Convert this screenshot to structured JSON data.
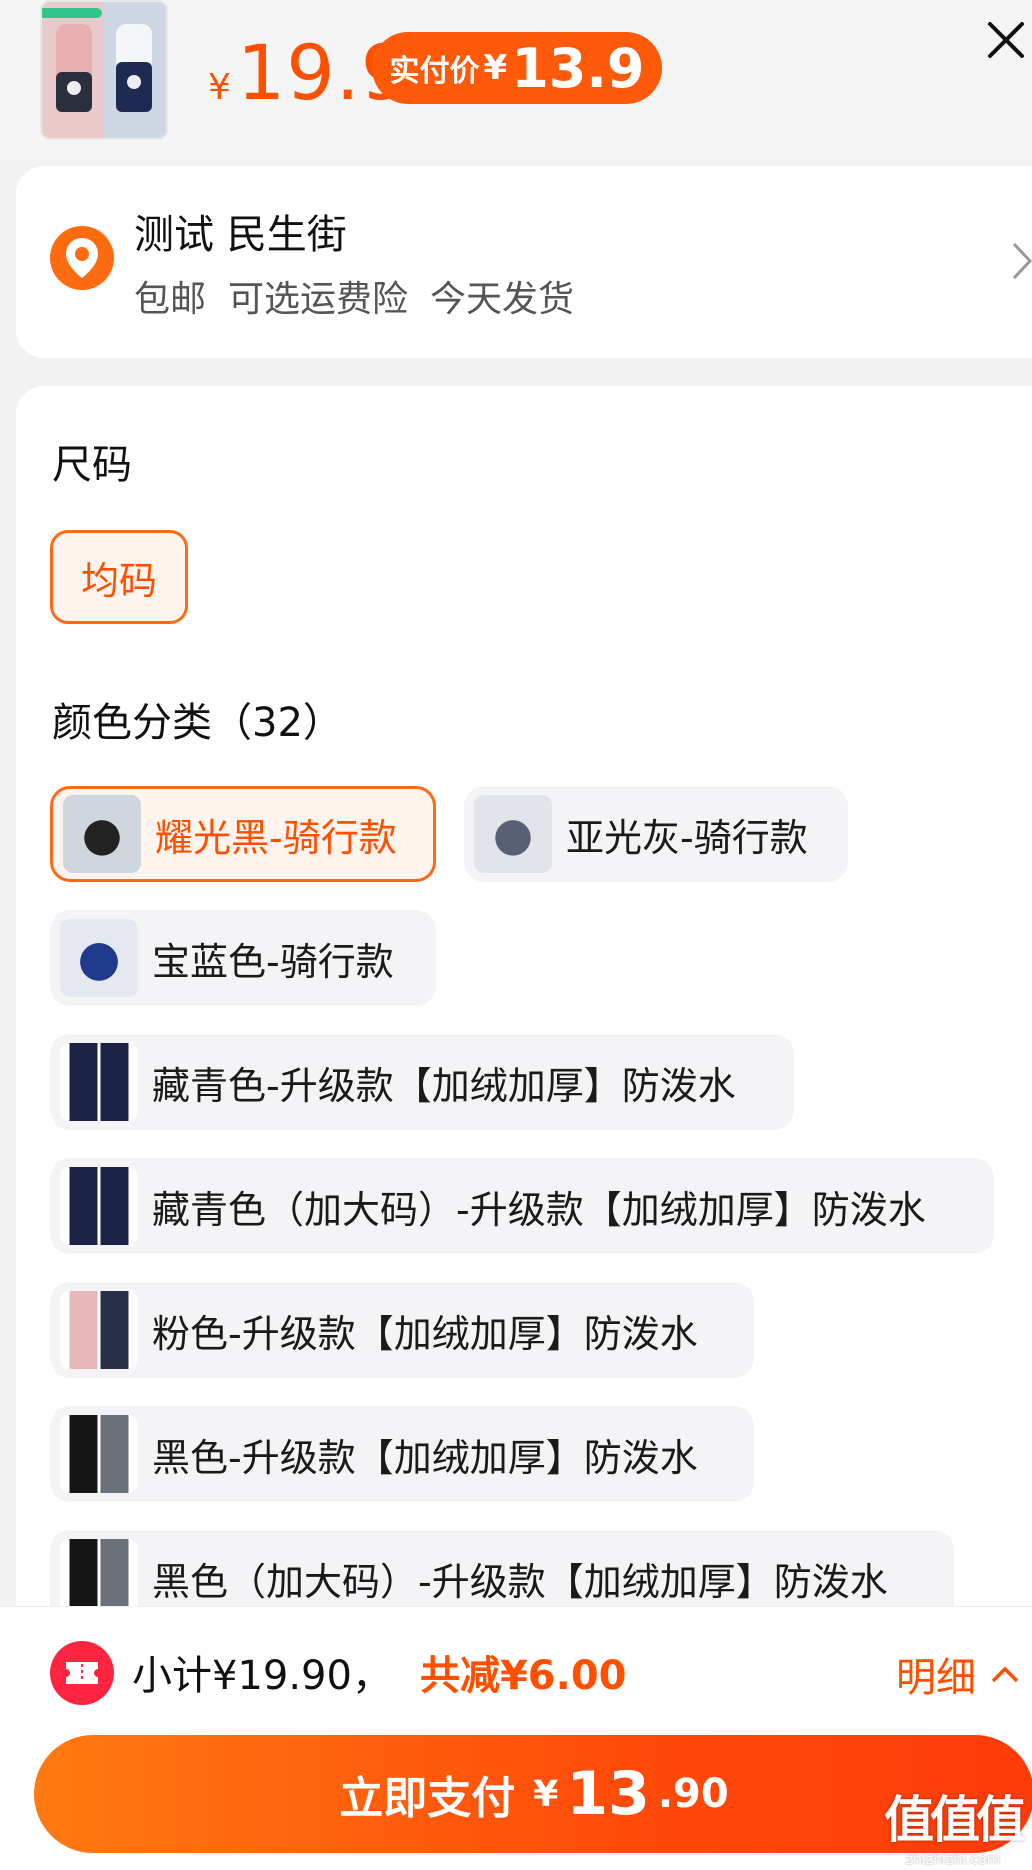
{
  "header": {
    "price_symbol": "¥",
    "price": "19.9",
    "real_price_label": "实付价",
    "real_price_symbol": "¥",
    "real_price": "13.9"
  },
  "address": {
    "title": "测试 民生街",
    "tags": [
      "包邮",
      "可选运费险",
      "今天发货"
    ]
  },
  "size": {
    "title": "尺码",
    "options": [
      "均码"
    ],
    "selected": "均码"
  },
  "color": {
    "title": "颜色分类（32）",
    "options": [
      {
        "label": "耀光黑-骑行款",
        "selected": true,
        "icon": "glove-black-thumb"
      },
      {
        "label": "亚光灰-骑行款",
        "selected": false,
        "icon": "glove-grey-thumb"
      },
      {
        "label": "宝蓝色-骑行款",
        "selected": false,
        "icon": "glove-blue-thumb"
      },
      {
        "label": "藏青色-升级款【加绒加厚】防泼水",
        "selected": false,
        "icon": "glove-navy-thumb"
      },
      {
        "label": "藏青色（加大码）-升级款【加绒加厚】防泼水",
        "selected": false,
        "icon": "glove-navy-thumb"
      },
      {
        "label": "粉色-升级款【加绒加厚】防泼水",
        "selected": false,
        "icon": "glove-pink-thumb"
      },
      {
        "label": "黑色-升级款【加绒加厚】防泼水",
        "selected": false,
        "icon": "glove-black-thumb"
      },
      {
        "label": "黑色（加大码）-升级款【加绒加厚】防泼水",
        "selected": false,
        "icon": "glove-black-thumb"
      }
    ]
  },
  "footer": {
    "subtotal": "小计¥19.90，",
    "discount": "共减¥6.00",
    "detail_label": "明细",
    "pay_label": "立即支付",
    "pay_symbol": "¥",
    "pay_int": "13",
    "pay_dec": ".90"
  },
  "watermark": {
    "logo_text": "值值值",
    "domain": "zhizhizhi.com"
  },
  "colors": {
    "accent": "#ff5000",
    "coupon": "#ff2540"
  }
}
